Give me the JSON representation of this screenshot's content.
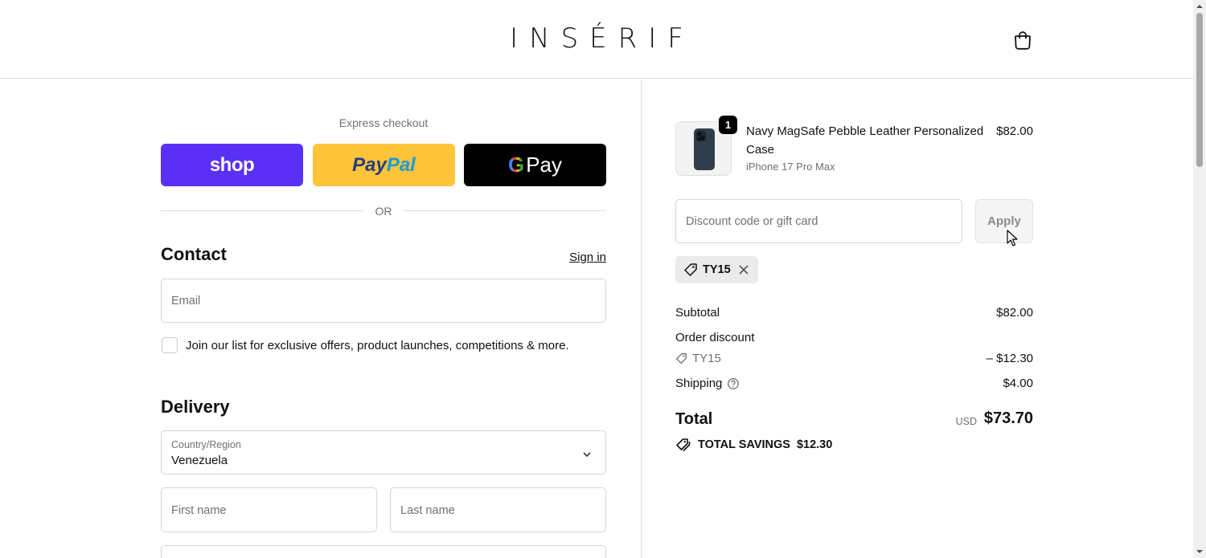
{
  "header": {
    "logo": "INSÉRIF",
    "cart_icon": "shopping-bag-icon"
  },
  "express": {
    "label": "Express checkout",
    "shop_label": "shop",
    "paypal_pay": "Pay",
    "paypal_pal": "Pal",
    "gpay_g": "G",
    "gpay_label": "Pay",
    "or_label": "OR"
  },
  "contact": {
    "title": "Contact",
    "signin": "Sign in",
    "email_placeholder": "Email",
    "newsletter_label": "Join our list for exclusive offers, product launches, competitions & more."
  },
  "delivery": {
    "title": "Delivery",
    "country_label": "Country/Region",
    "country_value": "Venezuela",
    "first_name_placeholder": "First name",
    "last_name_placeholder": "Last name"
  },
  "order": {
    "item": {
      "quantity": "1",
      "name": "Navy MagSafe Pebble Leather Personalized Case",
      "variant": "iPhone 17 Pro Max",
      "price": "$82.00"
    },
    "discount_placeholder": "Discount code or gift card",
    "apply_label": "Apply",
    "applied_code": "TY15",
    "subtotal_label": "Subtotal",
    "subtotal_value": "$82.00",
    "order_discount_label": "Order discount",
    "discount_code": "TY15",
    "discount_value": "– $12.30",
    "shipping_label": "Shipping",
    "shipping_value": "$4.00",
    "total_label": "Total",
    "total_currency": "USD",
    "total_value": "$73.70",
    "savings_label": "TOTAL SAVINGS",
    "savings_value": "$12.30"
  },
  "colors": {
    "shop_pay": "#5a31f4",
    "paypal": "#ffc439",
    "gpay": "#000000"
  }
}
